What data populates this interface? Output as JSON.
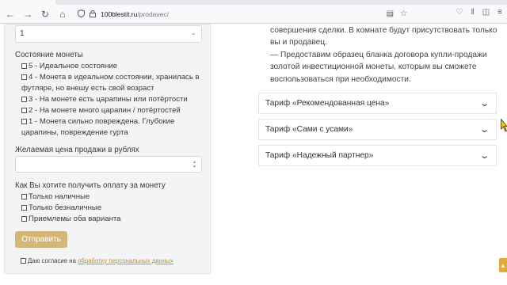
{
  "browser": {
    "prev_tab_label": "",
    "url_host": "100blestit.ru",
    "url_path": "/prodavec/"
  },
  "form": {
    "quantity_value": "1",
    "condition_label": "Состояние монеты",
    "condition_options": [
      "5 - Идеальное состояние",
      "4 - Монета в идеальном состоянии, хранилась в футляре, но внешу есть свой возраст",
      "3 - На монете есть царапины или потёртости",
      "2 - На монете много царапин / потёртостей",
      "1 - Монета сильно повреждена. Глубокие царапины, повреждение гурта"
    ],
    "price_label": "Желаемая цена продажи в рублях",
    "payment_label": "Как Вы хотите получить оплату за монету",
    "payment_options": [
      "Только наличные",
      "Только безналичные",
      "Приемлемы оба варианта"
    ],
    "submit_label": "Отправить",
    "consent_text": "Даю согласие на ",
    "consent_link": "обработку персональных данных"
  },
  "content": {
    "paragraph_lines": [
      "совершения сделки. В комнате будут присутствовать только",
      "вы и продавец.",
      "— Предоставим образец бланка договора купли-продажи",
      "золотой инвестиционной монеты, которым вы сможете",
      "воспользоваться при необходимости."
    ],
    "tariffs": [
      "Тариф «Рекомендованная цена»",
      "Тариф «Сами с усами»",
      "Тариф «Надежный партнер»"
    ]
  },
  "colors": {
    "accent_button": "#d4b678",
    "link": "#b8913f",
    "scroll_top": "#e0a93b"
  }
}
